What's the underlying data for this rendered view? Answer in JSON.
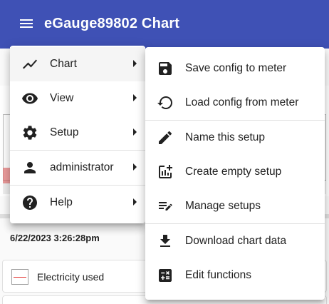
{
  "app": {
    "title": "eGauge89802 Chart"
  },
  "main_menu": {
    "items": [
      {
        "label": "Chart",
        "icon": "chart-line-icon",
        "has_submenu": true
      },
      {
        "label": "View",
        "icon": "eye-icon",
        "has_submenu": true
      },
      {
        "label": "Setup",
        "icon": "gear-icon",
        "has_submenu": true
      },
      {
        "label": "administrator",
        "icon": "person-icon",
        "has_submenu": true
      },
      {
        "label": "Help",
        "icon": "help-icon",
        "has_submenu": true
      }
    ]
  },
  "chart_submenu": {
    "items": [
      {
        "label": "Save config to meter",
        "icon": "save-icon"
      },
      {
        "label": "Load config from meter",
        "icon": "restore-icon"
      },
      {
        "label": "Name this setup",
        "icon": "pencil-icon"
      },
      {
        "label": "Create empty setup",
        "icon": "add-chart-icon"
      },
      {
        "label": "Manage setups",
        "icon": "playlist-edit-icon"
      },
      {
        "label": "Download chart data",
        "icon": "download-icon"
      },
      {
        "label": "Edit functions",
        "icon": "calculator-icon"
      }
    ]
  },
  "background": {
    "timestamp": "6/22/2023 3:26:28pm",
    "legend_label": "Electricity used",
    "series_color": "#e53935"
  },
  "colors": {
    "appbar": "#3f51b5"
  }
}
